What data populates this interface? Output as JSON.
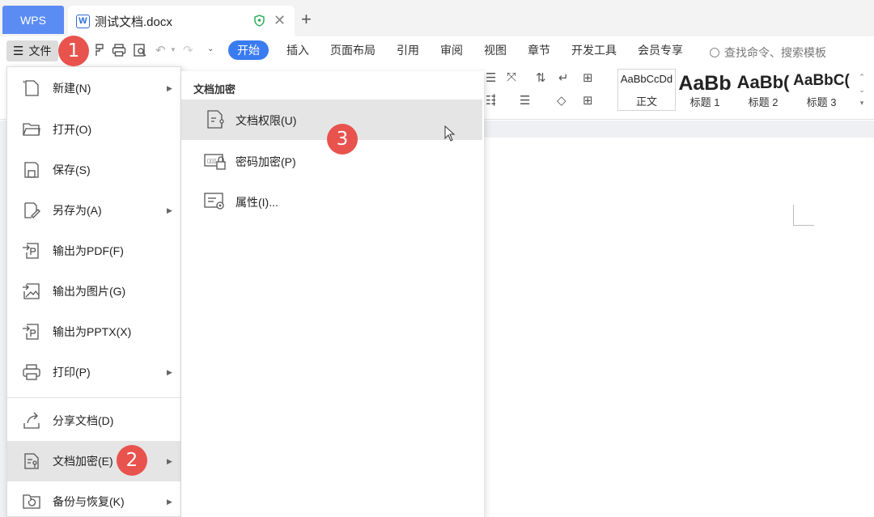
{
  "titlebar": {
    "wps_label": "WPS",
    "doc_name": "测试文档.docx",
    "doc_icon": "W"
  },
  "toolbar": {
    "file_label": "文件",
    "tabs": [
      "开始",
      "插入",
      "页面布局",
      "引用",
      "审阅",
      "视图",
      "章节",
      "开发工具",
      "会员专享"
    ],
    "active_tab": "开始",
    "search_placeholder": "查找命令、搜索模板"
  },
  "ribbon": {
    "styles": [
      {
        "sample": "AaBbCcDd",
        "label": "正文"
      },
      {
        "sample": "AaBb",
        "label": "标题 1"
      },
      {
        "sample": "AaBb(",
        "label": "标题 2"
      },
      {
        "sample": "AaBbC(",
        "label": "标题 3"
      }
    ]
  },
  "file_menu": {
    "items": [
      {
        "label": "新建(N)",
        "icon": "new-file-icon",
        "submenu": true
      },
      {
        "label": "打开(O)",
        "icon": "folder-open-icon",
        "submenu": false
      },
      {
        "label": "保存(S)",
        "icon": "save-icon",
        "submenu": false
      },
      {
        "label": "另存为(A)",
        "icon": "save-as-icon",
        "submenu": true
      },
      {
        "label": "输出为PDF(F)",
        "icon": "export-pdf-icon",
        "submenu": false
      },
      {
        "label": "输出为图片(G)",
        "icon": "export-image-icon",
        "submenu": false
      },
      {
        "label": "输出为PPTX(X)",
        "icon": "export-pptx-icon",
        "submenu": false
      },
      {
        "label": "打印(P)",
        "icon": "print-icon",
        "submenu": true
      },
      {
        "label": "分享文档(D)",
        "icon": "share-icon",
        "submenu": false
      },
      {
        "label": "文档加密(E)",
        "icon": "encrypt-icon",
        "submenu": true
      },
      {
        "label": "备份与恢复(K)",
        "icon": "backup-icon",
        "submenu": true
      }
    ]
  },
  "submenu": {
    "heading": "文档加密",
    "items": [
      {
        "label": "文档权限(U)",
        "icon": "doc-permission-icon"
      },
      {
        "label": "密码加密(P)",
        "icon": "password-lock-icon"
      },
      {
        "label": "属性(I)...",
        "icon": "properties-icon"
      }
    ]
  },
  "badges": [
    "1",
    "2",
    "3"
  ],
  "colors": {
    "accent": "#3a7bf0",
    "wps_tab": "#5b8cf3",
    "badge": "#e8534d",
    "hover": "#e5e5e5"
  }
}
